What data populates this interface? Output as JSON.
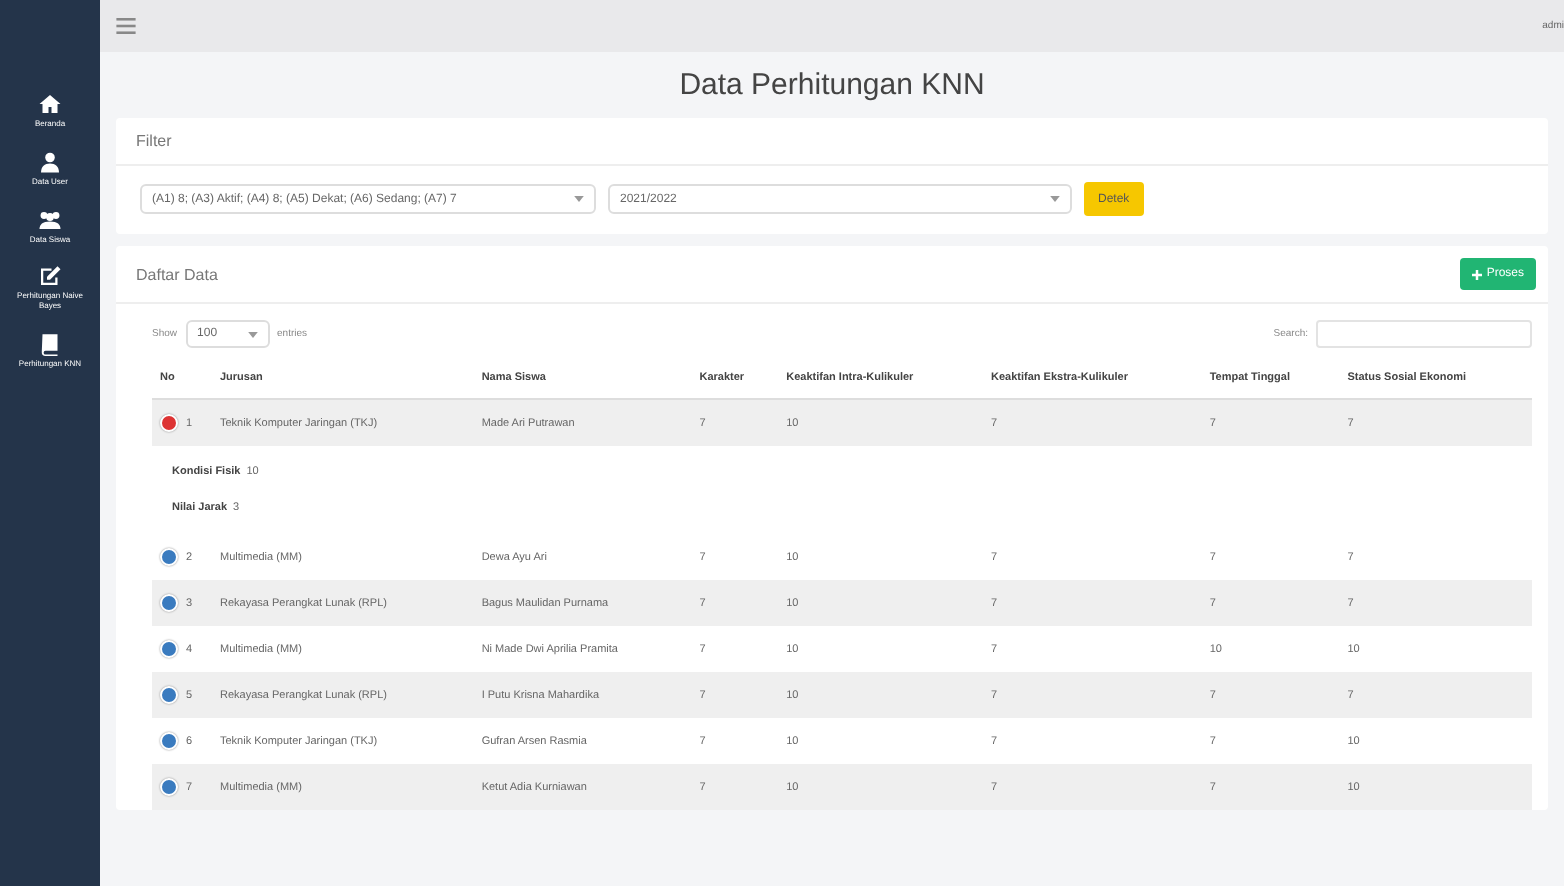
{
  "topbar": {
    "user": "admi"
  },
  "sidebar": {
    "items": [
      {
        "kind": "home",
        "label": "Beranda"
      },
      {
        "kind": "user",
        "label": "Data User"
      },
      {
        "kind": "users",
        "label": "Data Siswa"
      },
      {
        "kind": "edit",
        "label": "Perhitungan Naive Bayes"
      },
      {
        "kind": "book",
        "label": "Perhitungan KNN"
      }
    ]
  },
  "page_title": "Data Perhitungan KNN",
  "filter": {
    "title": "Filter",
    "criteria_value": "(A1) 8; (A3) Aktif; (A4) 8; (A5) Dekat; (A6) Sedang; (A7) 7",
    "year_value": "2021/2022",
    "button": "Detek"
  },
  "list": {
    "title": "Daftar Data",
    "process_button": "Proses",
    "show_label": "Show",
    "entries_value": "100",
    "entries_label": "entries",
    "search_label": "Search:",
    "columns": [
      "No",
      "Jurusan",
      "Nama Siswa",
      "Karakter",
      "Keaktifan Intra-Kulikuler",
      "Keaktifan Ekstra-Kulikuler",
      "Tempat Tinggal",
      "Status Sosial Ekonomi"
    ],
    "rows": [
      {
        "expanded": true,
        "cells": [
          "1",
          "Teknik Komputer Jaringan (TKJ)",
          "Made Ari Putrawan",
          "7",
          "10",
          "7",
          "7",
          "7"
        ],
        "details": [
          {
            "label": "Kondisi Fisik",
            "value": "10"
          },
          {
            "label": "Nilai Jarak",
            "value": "3"
          }
        ]
      },
      {
        "expanded": false,
        "cells": [
          "2",
          "Multimedia (MM)",
          "Dewa Ayu Ari",
          "7",
          "10",
          "7",
          "7",
          "7"
        ]
      },
      {
        "expanded": false,
        "cells": [
          "3",
          "Rekayasa Perangkat Lunak (RPL)",
          "Bagus Maulidan Purnama",
          "7",
          "10",
          "7",
          "7",
          "7"
        ]
      },
      {
        "expanded": false,
        "cells": [
          "4",
          "Multimedia (MM)",
          "Ni Made Dwi Aprilia Pramita",
          "7",
          "10",
          "7",
          "10",
          "10"
        ]
      },
      {
        "expanded": false,
        "cells": [
          "5",
          "Rekayasa Perangkat Lunak (RPL)",
          "I Putu Krisna Mahardika",
          "7",
          "10",
          "7",
          "7",
          "7"
        ]
      },
      {
        "expanded": false,
        "cells": [
          "6",
          "Teknik Komputer Jaringan (TKJ)",
          "Gufran Arsen Rasmia",
          "7",
          "10",
          "7",
          "7",
          "10"
        ]
      },
      {
        "expanded": false,
        "cells": [
          "7",
          "Multimedia (MM)",
          "Ketut Adia Kurniawan",
          "7",
          "10",
          "7",
          "7",
          "10"
        ]
      }
    ]
  }
}
